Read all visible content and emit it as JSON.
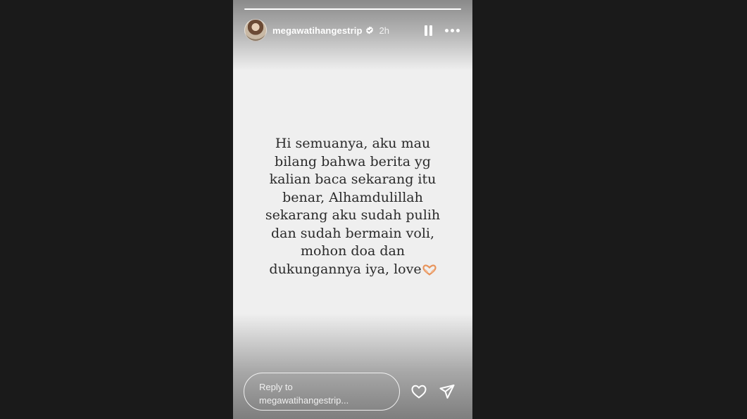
{
  "story": {
    "progress": 1.0,
    "username": "megawatihangestrip",
    "verified": true,
    "time_ago": "2h",
    "text_lines": [
      "Hi semuanya, aku mau",
      "bilang bahwa berita yg",
      "kalian baca sekarang itu",
      "benar, Alhamdulillah",
      "sekarang aku sudah pulih",
      "dan sudah bermain voli,",
      "mohon doa dan",
      "dukungannya iya, love"
    ],
    "trailing_emoji": "heart-hands-emoji"
  },
  "reply": {
    "line1": "Reply to",
    "line2": "megawatihangestrip..."
  },
  "icons": {
    "pause": "pause-icon",
    "more": "more-options-icon",
    "like": "heart-icon",
    "send": "send-icon"
  },
  "colors": {
    "background": "#1a1a1a",
    "story_bg": "#efefef",
    "text": "#2a2a2a",
    "emoji": "#e8935a"
  }
}
